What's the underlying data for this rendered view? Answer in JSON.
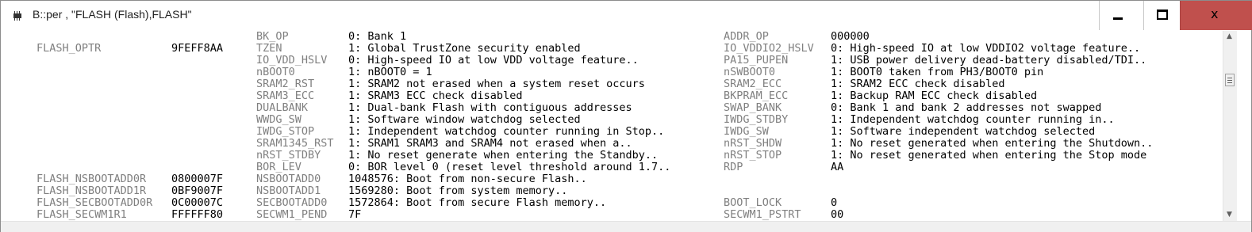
{
  "window": {
    "title": "B::per , \"FLASH (Flash),FLASH\"",
    "buttons": {
      "minimize": "minimize",
      "maximize": "maximize",
      "close": "x"
    },
    "close_color": "#c0504d"
  },
  "rows": [
    {
      "reg": "",
      "val": "",
      "f1": "BK_OP",
      "v1": "0: Bank 1",
      "f2": "ADDR_OP",
      "v2": "000000"
    },
    {
      "reg": "FLASH_OPTR",
      "val": "9FEFF8AA",
      "f1": "TZEN",
      "v1": "1: Global TrustZone security enabled",
      "f2": "IO_VDDIO2_HSLV",
      "v2": "0: High-speed IO at low VDDIO2 voltage feature.."
    },
    {
      "reg": "",
      "val": "",
      "f1": "IO_VDD_HSLV",
      "v1": "0: High-speed IO at low VDD voltage feature..",
      "f2": "PA15_PUPEN",
      "v2": "1: USB power delivery dead-battery disabled/TDI.."
    },
    {
      "reg": "",
      "val": "",
      "f1": "nBOOT0",
      "v1": "1: nBOOT0 = 1",
      "f2": "nSWBOOT0",
      "v2": "1: BOOT0 taken from PH3/BOOT0 pin"
    },
    {
      "reg": "",
      "val": "",
      "f1": "SRAM2_RST",
      "v1": "1: SRAM2 not erased when a system reset occurs",
      "f2": "SRAM2_ECC",
      "v2": "1: SRAM2 ECC check disabled"
    },
    {
      "reg": "",
      "val": "",
      "f1": "SRAM3_ECC",
      "v1": "1: SRAM3 ECC check disabled",
      "f2": "BKPRAM_ECC",
      "v2": "1: Backup RAM ECC check disabled"
    },
    {
      "reg": "",
      "val": "",
      "f1": "DUALBANK",
      "v1": "1: Dual-bank Flash with contiguous addresses",
      "f2": "SWAP_BANK",
      "v2": "0: Bank 1 and bank 2 addresses not swapped"
    },
    {
      "reg": "",
      "val": "",
      "f1": "WWDG_SW",
      "v1": "1: Software window watchdog selected",
      "f2": "IWDG_STDBY",
      "v2": "1: Independent watchdog counter running in.."
    },
    {
      "reg": "",
      "val": "",
      "f1": "IWDG_STOP",
      "v1": "1: Independent watchdog counter running in Stop..",
      "f2": "IWDG_SW",
      "v2": "1: Software independent watchdog selected"
    },
    {
      "reg": "",
      "val": "",
      "f1": "SRAM1345_RST",
      "v1": "1: SRAM1 SRAM3 and SRAM4 not erased when a..",
      "f2": "nRST_SHDW",
      "v2": "1: No reset generated when entering the Shutdown.."
    },
    {
      "reg": "",
      "val": "",
      "f1": "nRST_STDBY",
      "v1": "1: No reset generate when entering the Standby..",
      "f2": "nRST_STOP",
      "v2": "1: No reset generated when entering the Stop mode"
    },
    {
      "reg": "",
      "val": "",
      "f1": "BOR_LEV",
      "v1": "0: BOR level 0 (reset level threshold around 1.7..",
      "f2": "RDP",
      "v2": "AA"
    },
    {
      "reg": "FLASH_NSBOOTADD0R",
      "val": "0800007F",
      "f1": "NSBOOTADD0",
      "v1": "1048576: Boot from non-secure Flash..",
      "f2": "",
      "v2": ""
    },
    {
      "reg": "FLASH_NSBOOTADD1R",
      "val": "0BF9007F",
      "f1": "NSBOOTADD1",
      "v1": "1569280: Boot from system memory..",
      "f2": "",
      "v2": ""
    },
    {
      "reg": "FLASH_SECBOOTADD0R",
      "val": "0C00007C",
      "f1": "SECBOOTADD0",
      "v1": "1572864: Boot from secure Flash memory..",
      "f2": "BOOT_LOCK",
      "v2": "0"
    },
    {
      "reg": "FLASH_SECWM1R1",
      "val": "FFFFFF80",
      "f1": "SECWM1_PEND",
      "v1": "7F",
      "f2": "SECWM1_PSTRT",
      "v2": "00"
    }
  ]
}
